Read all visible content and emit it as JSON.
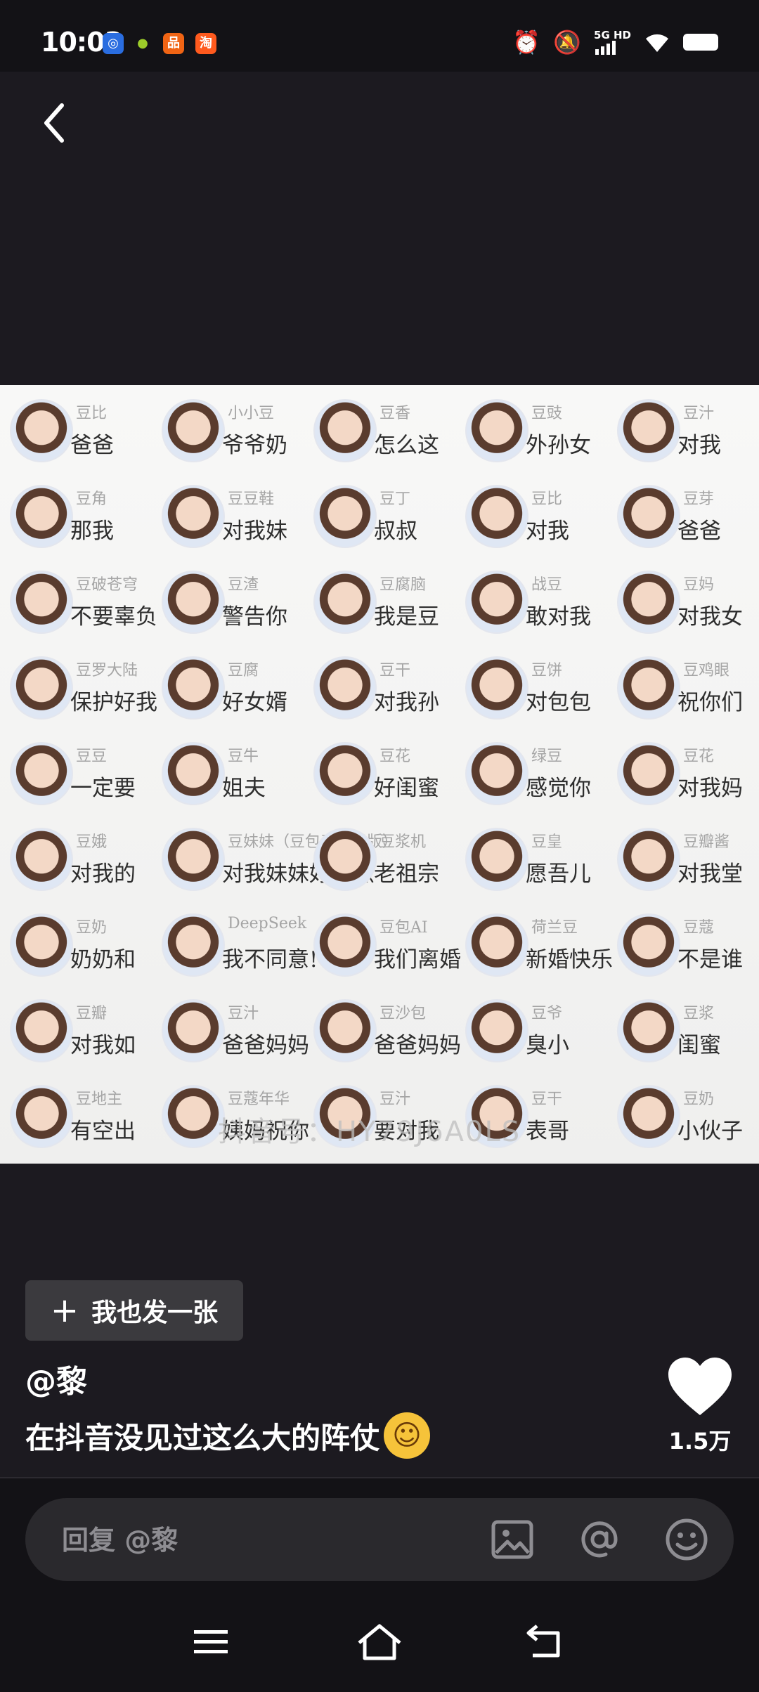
{
  "status_bar": {
    "time": "10:03",
    "network": "5G HD",
    "icons": [
      "alarm-icon",
      "mute-icon",
      "signal-icon",
      "wifi-icon",
      "battery-icon"
    ]
  },
  "collage": {
    "watermark": "抖音号：HY79J6A0LS",
    "columns": [
      [
        {
          "name": "豆比",
          "msg": "爸爸"
        },
        {
          "name": "豆角",
          "msg": "那我"
        },
        {
          "name": "豆破苍穹",
          "msg": "不要辜负"
        },
        {
          "name": "豆罗大陆",
          "msg": "保护好我"
        },
        {
          "name": "豆豆",
          "msg": "一定要"
        },
        {
          "name": "豆娥",
          "msg": "对我的"
        },
        {
          "name": "豆奶",
          "msg": "奶奶和"
        },
        {
          "name": "豆瓣",
          "msg": "对我如"
        },
        {
          "name": "豆地主",
          "msg": "有空出"
        }
      ],
      [
        {
          "name": "小小豆",
          "msg": "爷爷奶"
        },
        {
          "name": "豆豆鞋",
          "msg": "对我妹"
        },
        {
          "name": "豆渣",
          "msg": "警告你"
        },
        {
          "name": "豆腐",
          "msg": "好女婿"
        },
        {
          "name": "豆牛",
          "msg": "姐夫"
        },
        {
          "name": "豆妹妹（豆包表姐姐版）",
          "msg": "对我妹妹好一点"
        },
        {
          "name": "DeepSeek",
          "msg": "我不同意!"
        },
        {
          "name": "豆汁",
          "msg": "爸爸妈妈"
        },
        {
          "name": "豆蔻年华",
          "msg": "姨妈祝你"
        }
      ],
      [
        {
          "name": "豆香",
          "msg": "怎么这"
        },
        {
          "name": "豆丁",
          "msg": "叔叔"
        },
        {
          "name": "豆腐脑",
          "msg": "我是豆"
        },
        {
          "name": "豆干",
          "msg": "对我孙"
        },
        {
          "name": "豆花",
          "msg": "好闺蜜"
        },
        {
          "name": "豆浆机",
          "msg": "老祖宗"
        },
        {
          "name": "豆包AI",
          "msg": "我们离婚"
        },
        {
          "name": "豆沙包",
          "msg": "爸爸妈妈"
        },
        {
          "name": "豆汁",
          "msg": "要对我"
        }
      ],
      [
        {
          "name": "豆豉",
          "msg": "外孙女"
        },
        {
          "name": "豆比",
          "msg": "对我"
        },
        {
          "name": "战豆",
          "msg": "敢对我"
        },
        {
          "name": "豆饼",
          "msg": "对包包"
        },
        {
          "name": "绿豆",
          "msg": "感觉你"
        },
        {
          "name": "豆皇",
          "msg": "愿吾儿"
        },
        {
          "name": "荷兰豆",
          "msg": "新婚快乐"
        },
        {
          "name": "豆爷",
          "msg": "臭小"
        },
        {
          "name": "豆干",
          "msg": "表哥"
        }
      ],
      [
        {
          "name": "豆汁",
          "msg": "对我"
        },
        {
          "name": "豆芽",
          "msg": "爸爸"
        },
        {
          "name": "豆妈",
          "msg": "对我女"
        },
        {
          "name": "豆鸡眼",
          "msg": "祝你们"
        },
        {
          "name": "豆花",
          "msg": "对我妈"
        },
        {
          "name": "豆瓣酱",
          "msg": "对我堂"
        },
        {
          "name": "豆蔻",
          "msg": "不是谁"
        },
        {
          "name": "豆浆",
          "msg": "闺蜜"
        },
        {
          "name": "豆奶",
          "msg": "小伙子"
        }
      ]
    ]
  },
  "post": {
    "add_label": "我也发一张",
    "author": "@黎",
    "caption": "在抖音没见过这么大的阵仗",
    "likes": "1.5万"
  },
  "reply": {
    "placeholder": "回复 @黎"
  },
  "colors": {
    "background": "#1c1a20",
    "bar": "#131216",
    "button": "#3b3a3e",
    "input": "#2a292d"
  }
}
